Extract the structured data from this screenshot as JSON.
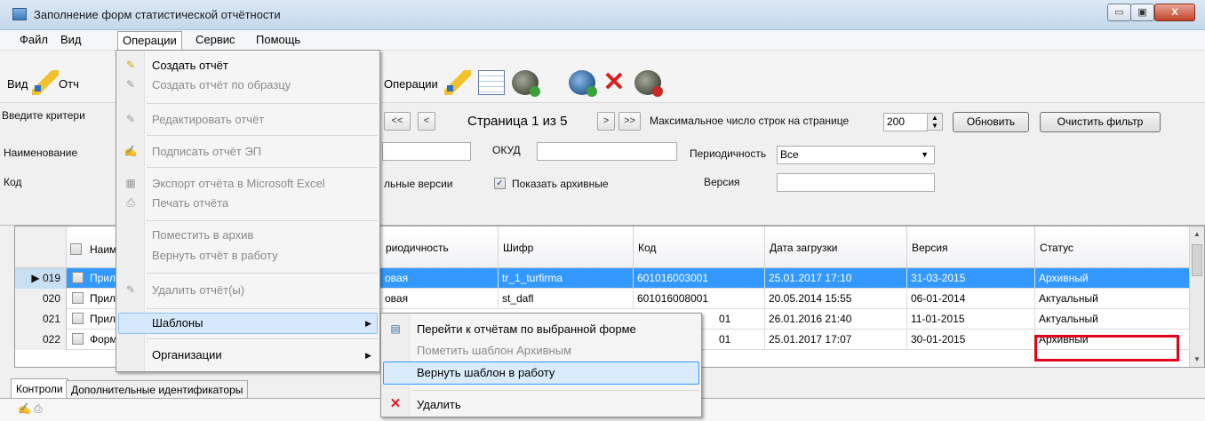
{
  "window": {
    "title": "Заполнение форм статистической отчётности",
    "minimize": "▭",
    "maximize": "▣",
    "close": "X"
  },
  "menubar": {
    "items": [
      "Файл",
      "Вид",
      "Операции",
      "Сервис",
      "Помощь"
    ],
    "active": "Операции"
  },
  "toolbar": {
    "view_label": "Вид",
    "reports_label_partial": "Отч",
    "operations_label": "Операции"
  },
  "filter": {
    "criteria_label": "Введите критери",
    "name_label": "Наименование",
    "code_label": "Код",
    "first_page": "<<",
    "prev_page": "<",
    "page_text": "Страница 1 из 5",
    "next_page": ">",
    "last_page": ">>",
    "max_rows_label": "Максимальное число строк на странице",
    "max_rows_value": "200",
    "refresh_button": "Обновить",
    "clear_button": "Очистить фильтр",
    "okud_label": "ОКУД",
    "okud_value": "",
    "periodicity_label": "Периодичность",
    "periodicity_value": "Все",
    "actual_versions_partial": "льные версии",
    "show_archived_label": "Показать архивные",
    "show_archived_checked": true,
    "version_label": "Версия",
    "version_value": ""
  },
  "grid": {
    "headers": {
      "name_partial": "Наим",
      "periodicity": "риодичность",
      "cipher": "Шифр",
      "code": "Код",
      "upload_date": "Дата загрузки",
      "version": "Версия",
      "status": "Статус"
    },
    "rows": [
      {
        "num": "019",
        "name": "Прил",
        "periodicity": "овая",
        "cipher": "tr_1_turfirma",
        "code": "601016003001",
        "date": "25.01.2017 17:10",
        "version": "31-03-2015",
        "status": "Архивный",
        "selected": true
      },
      {
        "num": "020",
        "name": "Прил",
        "periodicity": "овая",
        "cipher": "st_dafl",
        "code": "601016008001",
        "date": "20.05.2014 15:55",
        "version": "06-01-2014",
        "status": "Актуальный",
        "selected": false
      },
      {
        "num": "021",
        "name": "Прил",
        "periodicity": "",
        "cipher": "",
        "code": "01",
        "date": "26.01.2016 21:40",
        "version": "11-01-2015",
        "status": "Актуальный",
        "selected": false
      },
      {
        "num": "022",
        "name": "Форм",
        "periodicity": "",
        "cipher": "",
        "code": "01",
        "date": "25.01.2017 17:07",
        "version": "30-01-2015",
        "status": "Архивный",
        "selected": false
      }
    ]
  },
  "operations_menu": {
    "items": [
      "Создать отчёт",
      "Создать отчёт по образцу",
      "Редактировать отчёт",
      "Подписать отчёт ЭП",
      "Экспорт отчёта в Microsoft Excel",
      "Печать отчёта",
      "Поместить в архив",
      "Вернуть отчёт в работу",
      "Удалить отчёт(ы)",
      "Шаблоны",
      "Организации"
    ]
  },
  "templates_submenu": {
    "items": [
      "Перейти к отчётам по выбранной форме",
      "Пометить шаблон Архивным",
      "Вернуть шаблон в работу",
      "Удалить"
    ]
  },
  "tabs": {
    "items": [
      "Контроли",
      "Дополнительные идентификаторы"
    ]
  },
  "colors": {
    "selection": "#3399ff",
    "highlight_box": "#e3001b",
    "delete_icon": "#d81e1e"
  }
}
